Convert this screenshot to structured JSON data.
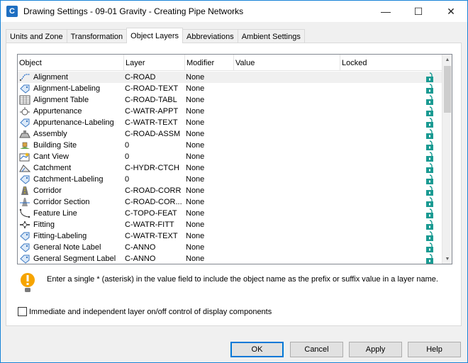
{
  "window": {
    "app_icon_letter": "C",
    "title": "Drawing Settings - 09-01 Gravity - Creating Pipe Networks",
    "minimize": "—",
    "maximize": "☐",
    "close": "✕"
  },
  "tabs": [
    {
      "label": "Units and Zone",
      "active": false
    },
    {
      "label": "Transformation",
      "active": false
    },
    {
      "label": "Object Layers",
      "active": true
    },
    {
      "label": "Abbreviations",
      "active": false
    },
    {
      "label": "Ambient Settings",
      "active": false
    }
  ],
  "grid": {
    "columns": [
      "Object",
      "Layer",
      "Modifier",
      "Value",
      "Locked"
    ],
    "rows": [
      {
        "object": "Alignment",
        "icon": "alignment-icon",
        "layer": "C-ROAD",
        "modifier": "None",
        "value": "",
        "locked": "unlocked"
      },
      {
        "object": "Alignment-Labeling",
        "icon": "label-tag-icon",
        "layer": "C-ROAD-TEXT",
        "modifier": "None",
        "value": "",
        "locked": "unlocked"
      },
      {
        "object": "Alignment Table",
        "icon": "table-icon",
        "layer": "C-ROAD-TABL",
        "modifier": "None",
        "value": "",
        "locked": "unlocked"
      },
      {
        "object": "Appurtenance",
        "icon": "appurtenance-icon",
        "layer": "C-WATR-APPT",
        "modifier": "None",
        "value": "",
        "locked": "unlocked"
      },
      {
        "object": "Appurtenance-Labeling",
        "icon": "label-tag-icon",
        "layer": "C-WATR-TEXT",
        "modifier": "None",
        "value": "",
        "locked": "unlocked"
      },
      {
        "object": "Assembly",
        "icon": "assembly-icon",
        "layer": "C-ROAD-ASSM",
        "modifier": "None",
        "value": "",
        "locked": "unlocked"
      },
      {
        "object": "Building Site",
        "icon": "building-site-icon",
        "layer": "0",
        "modifier": "None",
        "value": "",
        "locked": "unlocked"
      },
      {
        "object": "Cant View",
        "icon": "cant-view-icon",
        "layer": "0",
        "modifier": "None",
        "value": "",
        "locked": "unlocked"
      },
      {
        "object": "Catchment",
        "icon": "catchment-icon",
        "layer": "C-HYDR-CTCH",
        "modifier": "None",
        "value": "",
        "locked": "unlocked"
      },
      {
        "object": "Catchment-Labeling",
        "icon": "label-tag-icon",
        "layer": "0",
        "modifier": "None",
        "value": "",
        "locked": "unlocked"
      },
      {
        "object": "Corridor",
        "icon": "corridor-icon",
        "layer": "C-ROAD-CORR",
        "modifier": "None",
        "value": "",
        "locked": "unlocked"
      },
      {
        "object": "Corridor Section",
        "icon": "corridor-section-icon",
        "layer": "C-ROAD-COR...",
        "modifier": "None",
        "value": "",
        "locked": "unlocked"
      },
      {
        "object": "Feature Line",
        "icon": "feature-line-icon",
        "layer": "C-TOPO-FEAT",
        "modifier": "None",
        "value": "",
        "locked": "unlocked"
      },
      {
        "object": "Fitting",
        "icon": "fitting-icon",
        "layer": "C-WATR-FITT",
        "modifier": "None",
        "value": "",
        "locked": "unlocked"
      },
      {
        "object": "Fitting-Labeling",
        "icon": "label-tag-icon",
        "layer": "C-WATR-TEXT",
        "modifier": "None",
        "value": "",
        "locked": "unlocked"
      },
      {
        "object": "General Note Label",
        "icon": "label-tag-icon",
        "layer": "C-ANNO",
        "modifier": "None",
        "value": "",
        "locked": "unlocked"
      },
      {
        "object": "General Segment Label",
        "icon": "label-tag-icon",
        "layer": "C-ANNO",
        "modifier": "None",
        "value": "",
        "locked": "unlocked"
      }
    ]
  },
  "info": {
    "icon": "warning-lightbulb-icon",
    "text": "Enter a single * (asterisk) in the value field to include the object name as the prefix or suffix value in a layer name."
  },
  "checkbox": {
    "label": "Immediate and independent layer on/off control of display components",
    "checked": false
  },
  "buttons": {
    "ok": "OK",
    "cancel": "Cancel",
    "apply": "Apply",
    "help": "Help"
  },
  "colors": {
    "accent": "#0078d7",
    "lock": "#1a9a92"
  }
}
